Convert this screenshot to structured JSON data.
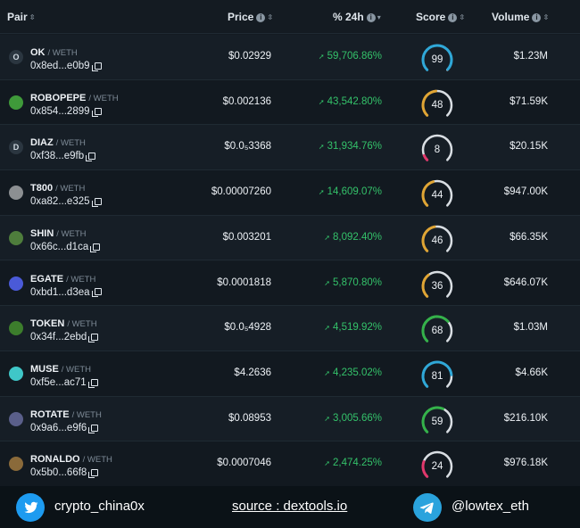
{
  "header": {
    "pair": "Pair",
    "price": "Price",
    "change": "% 24h",
    "score": "Score",
    "volume": "Volume"
  },
  "rows": [
    {
      "symbol": "OK",
      "base": "/ WETH",
      "address": "0x8ed...e0b9",
      "price": "$0.02929",
      "change": "59,706.86%",
      "score": "99",
      "score_value": 99,
      "score_color": "#2fa8d8",
      "volume": "$1.23M",
      "avatar": "O",
      "avatar_color": "#2b3640"
    },
    {
      "symbol": "ROBOPEPE",
      "base": "/ WETH",
      "address": "0x854...2899",
      "price": "$0.002136",
      "change": "43,542.80%",
      "score": "48",
      "score_value": 48,
      "score_color": "#e0a534",
      "volume": "$71.59K",
      "avatar": "",
      "avatar_color": "#3f9a3a"
    },
    {
      "symbol": "DIAZ",
      "base": "/ WETH",
      "address": "0xf38...e9fb",
      "price": "$0.0₅3368",
      "change": "31,934.76%",
      "score": "8",
      "score_value": 8,
      "score_color": "#e0376b",
      "volume": "$20.15K",
      "avatar": "D",
      "avatar_color": "#2b3640"
    },
    {
      "symbol": "T800",
      "base": "/ WETH",
      "address": "0xa82...e325",
      "price": "$0.00007260",
      "change": "14,609.07%",
      "score": "44",
      "score_value": 44,
      "score_color": "#e0a534",
      "volume": "$947.00K",
      "avatar": "",
      "avatar_color": "#8c8f92"
    },
    {
      "symbol": "SHIN",
      "base": "/ WETH",
      "address": "0x66c...d1ca",
      "price": "$0.003201",
      "change": "8,092.40%",
      "score": "46",
      "score_value": 46,
      "score_color": "#e0a534",
      "volume": "$66.35K",
      "avatar": "",
      "avatar_color": "#4e7d3c"
    },
    {
      "symbol": "EGATE",
      "base": "/ WETH",
      "address": "0xbd1...d3ea",
      "price": "$0.0001818",
      "change": "5,870.80%",
      "score": "36",
      "score_value": 36,
      "score_color": "#e0a534",
      "volume": "$646.07K",
      "avatar": "",
      "avatar_color": "#4a5ad8"
    },
    {
      "symbol": "TOKEN",
      "base": "/ WETH",
      "address": "0x34f...2ebd",
      "price": "$0.0₅4928",
      "change": "4,519.92%",
      "score": "68",
      "score_value": 68,
      "score_color": "#34b24a",
      "volume": "$1.03M",
      "avatar": "",
      "avatar_color": "#3c7d2c"
    },
    {
      "symbol": "MUSE",
      "base": "/ WETH",
      "address": "0xf5e...ac71",
      "price": "$4.2636",
      "change": "4,235.02%",
      "score": "81",
      "score_value": 81,
      "score_color": "#2fa8d8",
      "volume": "$4.66K",
      "avatar": "",
      "avatar_color": "#3fc7c8"
    },
    {
      "symbol": "ROTATE",
      "base": "/ WETH",
      "address": "0x9a6...e9f6",
      "price": "$0.08953",
      "change": "3,005.66%",
      "score": "59",
      "score_value": 59,
      "score_color": "#34b24a",
      "volume": "$216.10K",
      "avatar": "",
      "avatar_color": "#5a5f8a"
    },
    {
      "symbol": "RONALDO",
      "base": "/ WETH",
      "address": "0x5b0...66f8",
      "price": "$0.0007046",
      "change": "2,474.25%",
      "score": "24",
      "score_value": 24,
      "score_color": "#e0376b",
      "volume": "$976.18K",
      "avatar": "",
      "avatar_color": "#8a6a3a"
    }
  ],
  "footer": {
    "twitter_handle": "crypto_china0x",
    "source": "source : dextools.io",
    "telegram_handle": "@lowtex_eth"
  },
  "colors": {
    "positive": "#34c26a",
    "twitter": "#1d9bf0",
    "telegram": "#2aa3dd"
  }
}
